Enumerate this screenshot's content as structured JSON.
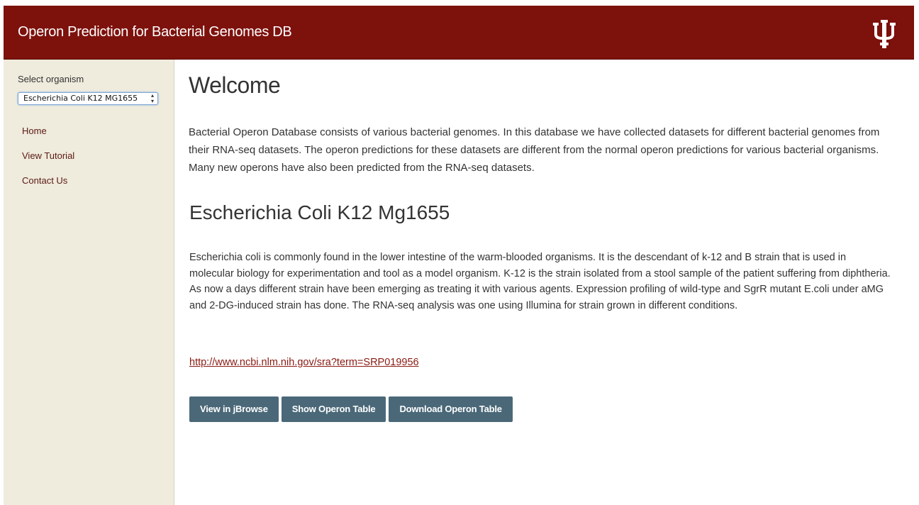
{
  "header": {
    "title": "Operon Prediction for Bacterial Genomes DB",
    "logo_icon": "iu-trident-logo"
  },
  "colors": {
    "header_bg": "#7d110c",
    "sidebar_bg": "#efebdd",
    "button_bg": "#4a6878",
    "link": "#8a1a12"
  },
  "sidebar": {
    "select_label": "Select organism",
    "selected_organism": "Escherichia Coli K12 MG1655",
    "nav": [
      {
        "label": "Home"
      },
      {
        "label": "View Tutorial"
      },
      {
        "label": "Contact Us"
      }
    ]
  },
  "main": {
    "welcome_title": "Welcome",
    "intro": "Bacterial Operon Database consists of various bacterial genomes. In this database we have collected datasets for different bacterial genomes from their RNA-seq datasets. The operon predictions for these datasets are different from the normal operon predictions for various bacterial organisms. Many new operons have also been predicted from the RNA-seq datasets.",
    "organism_title": "Escherichia Coli K12 Mg1655",
    "organism_description": "Escherichia coli is commonly found in the lower intestine of the warm-blooded organisms. It is the descendant of k-12 and B strain that is used in molecular biology for experimentation and tool as a model organism. K-12 is the strain isolated from a stool sample of the patient suffering from diphtheria. As now a days different strain have been emerging as treating it with various agents. Expression profiling of wild-type and SgrR mutant E.coli under aMG and 2-DG-induced strain has done. The RNA-seq analysis was one using Illumina for strain grown in different conditions.",
    "sra_link": "http://www.ncbi.nlm.nih.gov/sra?term=SRP019956",
    "buttons": {
      "jbrowse": "View in jBrowse",
      "show_table": "Show Operon Table",
      "download_table": "Download Operon Table"
    }
  }
}
